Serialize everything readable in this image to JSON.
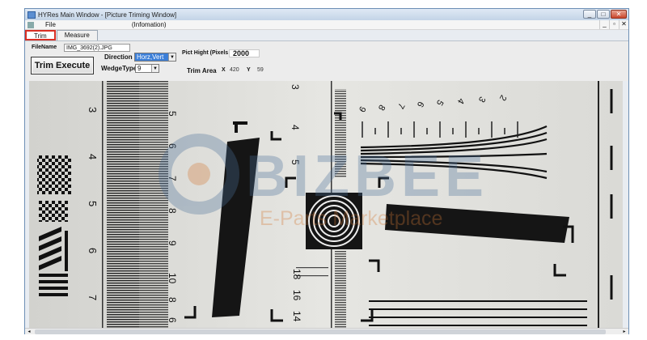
{
  "window": {
    "title": "HYRes Main Window - [Picture Triming Window]",
    "controls": [
      "_",
      "□",
      "✕"
    ]
  },
  "menu": {
    "file": "File",
    "information": "(Infomation)",
    "mdi_controls": [
      "_",
      "▫",
      "✕"
    ]
  },
  "tabs": [
    {
      "label": "Trim",
      "active": true
    },
    {
      "label": "Measure",
      "active": false
    }
  ],
  "form": {
    "filename_label": "FileName",
    "filename": "IMG_3692(2).JPG",
    "direction_label": "Direction",
    "direction_value": "Horz,Vert",
    "trim_execute": "Trim Execute",
    "wedge_label": "WedgeType",
    "wedge_value": "9",
    "pict_height_label": "Pict Hight (Pixels",
    "pict_height_value": "2000",
    "trim_area_label": "Trim Area",
    "x_label": "X",
    "x_value": "420",
    "y_label": "Y",
    "y_value": "59"
  },
  "image": {
    "ruler_numbers": [
      "3",
      "4",
      "5",
      "6",
      "7"
    ],
    "center_numbers_top": [
      "3",
      "4",
      "5"
    ],
    "center_numbers_bottom": [
      "18",
      "16",
      "14",
      "12"
    ],
    "left_wedge_numbers": [
      "5",
      "6",
      "7",
      "8",
      "9",
      "10",
      "8",
      "6"
    ],
    "right_numbers": [
      "9",
      "8",
      "7",
      "6",
      "5",
      "4",
      "3",
      "2"
    ],
    "watermark_brand": "BIZBEE",
    "watermark_sub": "E-Parts Marketplace"
  }
}
